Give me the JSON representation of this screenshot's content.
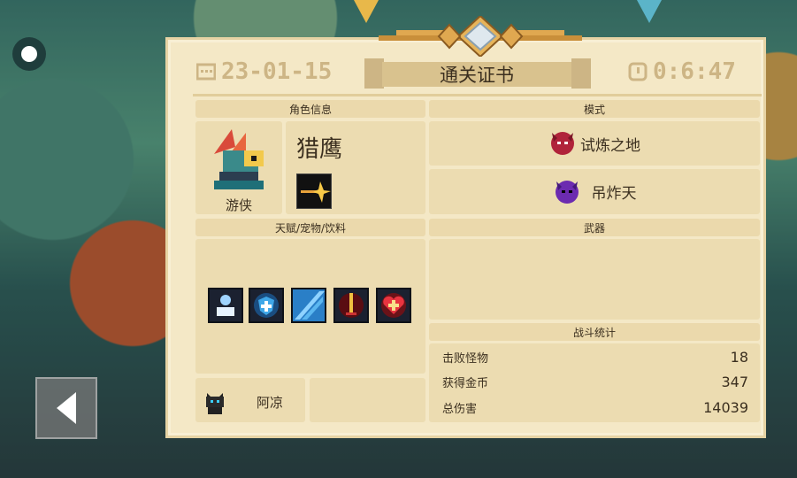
{
  "certificate": {
    "title": "通关证书",
    "date": "23-01-15",
    "time": "0:6:47"
  },
  "character": {
    "section_label": "角色信息",
    "name": "猎鹰",
    "class_name": "游侠"
  },
  "mode": {
    "section_label": "模式",
    "mode_name": "试炼之地",
    "sub_mode": "吊炸天"
  },
  "talents": {
    "section_label": "天赋/宠物/饮料",
    "icons": [
      "spirit-icon",
      "shield-plus-icon",
      "blue-slash-icon",
      "red-sword-icon",
      "heart-plus-icon"
    ]
  },
  "pet": {
    "name": "阿凉"
  },
  "weapons": {
    "section_label": "武器"
  },
  "battle_stats": {
    "section_label": "战斗统计",
    "rows": [
      {
        "label": "击败怪物",
        "value": "18"
      },
      {
        "label": "获得金币",
        "value": "347"
      },
      {
        "label": "总伤害",
        "value": "14039"
      }
    ]
  },
  "colors": {
    "panel_bg": "#f4e8c6",
    "box_bg": "#ecdcb1",
    "header_bg": "#ebd9ac",
    "accent_gold": "#cdb585"
  }
}
